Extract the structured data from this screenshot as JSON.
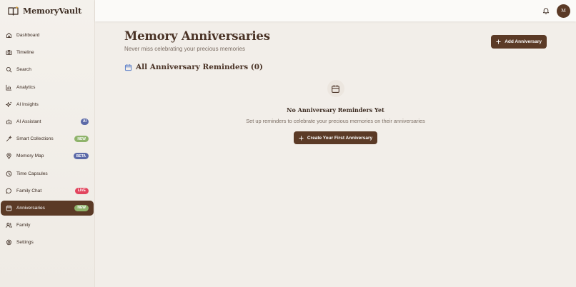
{
  "app": {
    "name": "MemoryVault"
  },
  "colors": {
    "primary": "#5b3a26",
    "badge_ai": "#5c6aa8",
    "badge_new": "#8fb36b",
    "badge_beta": "#5c6aa8",
    "badge_live": "#e2455e",
    "calendar_icon": "#5b7fc9"
  },
  "sidebar": {
    "items": [
      {
        "label": "Dashboard",
        "icon": "home-icon"
      },
      {
        "label": "Timeline",
        "icon": "camera-icon"
      },
      {
        "label": "Search",
        "icon": "search-icon"
      },
      {
        "label": "Analytics",
        "icon": "bar-chart-icon"
      },
      {
        "label": "AI Insights",
        "icon": "sparkles-icon"
      },
      {
        "label": "AI Assistant",
        "icon": "bot-icon",
        "badge": "AI"
      },
      {
        "label": "Smart Collections",
        "icon": "magic-wand-icon",
        "badge": "NEW"
      },
      {
        "label": "Memory Map",
        "icon": "map-pin-icon",
        "badge": "BETA"
      },
      {
        "label": "Time Capsules",
        "icon": "clock-icon"
      },
      {
        "label": "Family Chat",
        "icon": "chat-icon",
        "badge": "LIVE"
      },
      {
        "label": "Anniversaries",
        "icon": "calendar-icon",
        "badge": "NEW",
        "active": true
      },
      {
        "label": "Family",
        "icon": "users-icon"
      },
      {
        "label": "Settings",
        "icon": "gear-icon"
      }
    ]
  },
  "topbar": {
    "avatar_initial": "M",
    "notification_icon": "bell-icon"
  },
  "page": {
    "title": "Memory Anniversaries",
    "subtitle": "Never miss celebrating your precious memories",
    "add_button": "Add Anniversary",
    "section_title": "All Anniversary Reminders (0)"
  },
  "empty_state": {
    "title": "No Anniversary Reminders Yet",
    "text": "Set up reminders to celebrate your precious memories on their anniversaries",
    "button": "Create Your First Anniversary"
  }
}
